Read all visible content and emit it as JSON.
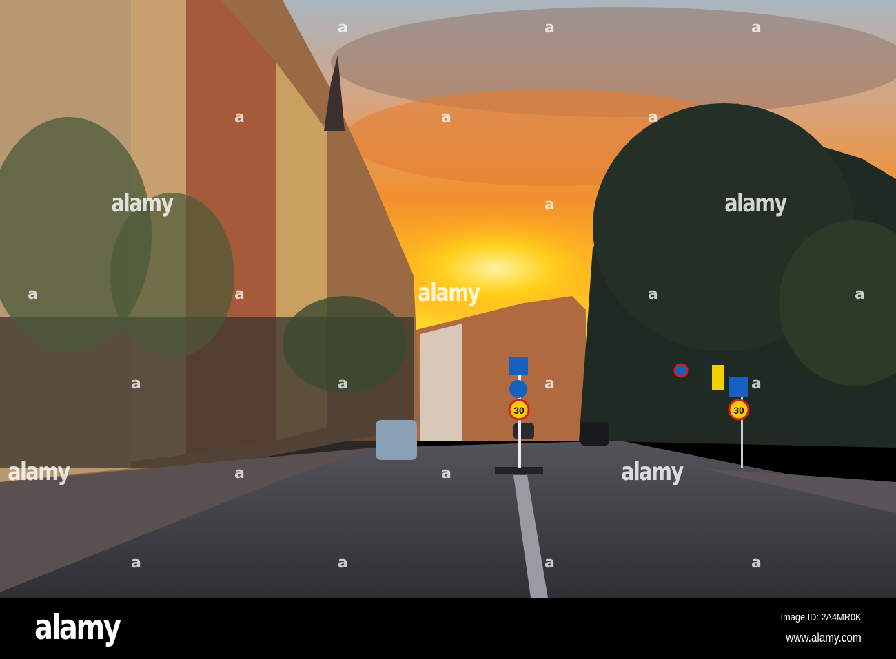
{
  "photo": {
    "speed_sign": "30",
    "colors": {
      "sky_top": "#9fb0bf",
      "sun": "#ffd21a",
      "cloud": "#f08a2a",
      "road": "#3a3b40",
      "trees": "#1c2520",
      "building": "#c4824e"
    }
  },
  "watermark": {
    "mark": "a",
    "word": "alamy"
  },
  "footer": {
    "logo": "alamy",
    "image_id": "Image ID: 2A4MR0K",
    "website": "www.alamy.com"
  }
}
